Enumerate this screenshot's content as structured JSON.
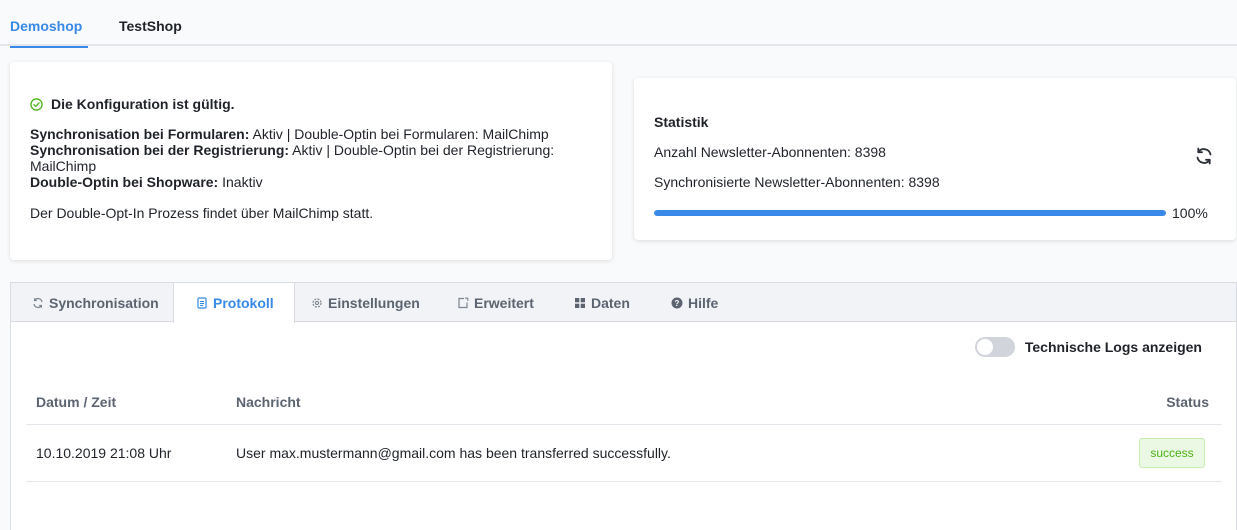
{
  "shop_tabs": [
    {
      "label": "Demoshop",
      "active": true
    },
    {
      "label": "TestShop",
      "active": false
    }
  ],
  "config": {
    "valid_text": "Die Konfiguration ist gültig.",
    "line1_label": "Synchronisation bei Formularen:",
    "line1_value": " Aktiv | Double-Optin bei Formularen: MailChimp",
    "line2_label": "Synchronisation bei der Registrierung:",
    "line2_value": " Aktiv | Double-Optin bei der Registrierung: MailChimp",
    "line3_label": "Double-Optin bei Shopware:",
    "line3_value": " Inaktiv",
    "note": "Der Double-Opt-In Prozess findet über MailChimp statt."
  },
  "stats": {
    "title": "Statistik",
    "subscribers": "Anzahl Newsletter-Abonnenten: 8398",
    "synced": "Synchronisierte Newsletter-Abonnenten: 8398",
    "progress": 1.0,
    "progress_label": "100%"
  },
  "module_tabs": [
    {
      "label": "Synchronisation",
      "icon": "sync-icon",
      "active": false
    },
    {
      "label": "Protokoll",
      "icon": "document-icon",
      "active": true
    },
    {
      "label": "Einstellungen",
      "icon": "gear-icon",
      "active": false
    },
    {
      "label": "Erweitert",
      "icon": "external-icon",
      "active": false
    },
    {
      "label": "Daten",
      "icon": "grid-icon",
      "active": false
    },
    {
      "label": "Hilfe",
      "icon": "help-icon",
      "active": false
    }
  ],
  "toggle": {
    "label": "Technische Logs anzeigen",
    "on": false
  },
  "log_table": {
    "headers": {
      "date": "Datum / Zeit",
      "message": "Nachricht",
      "status": "Status"
    },
    "rows": [
      {
        "date": "10.10.2019 21:08 Uhr",
        "message": "User max.mustermann@gmail.com has been transferred successfully.",
        "status": "success"
      }
    ]
  },
  "colors": {
    "accent": "#3889e8",
    "success": "#4bb316",
    "valid": "#4bb316"
  }
}
